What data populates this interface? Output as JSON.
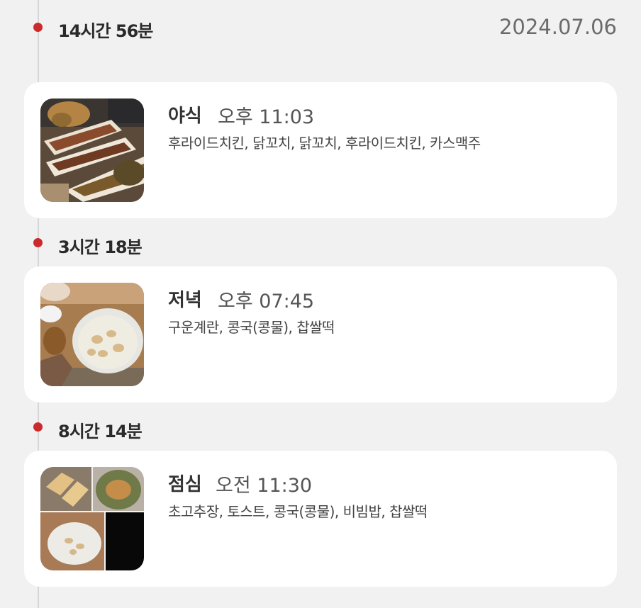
{
  "header": {
    "date": "2024.07.06"
  },
  "gaps": [
    {
      "label": "14시간 56분"
    },
    {
      "label": "3시간 18분"
    },
    {
      "label": "8시간 14분"
    }
  ],
  "meals": [
    {
      "type": "야식",
      "time": "오후 11:03",
      "foods": "후라이드치킨, 닭꼬치, 닭꼬치, 후라이드치킨, 카스맥주",
      "photo": "fried-chicken-skewers-photo"
    },
    {
      "type": "저녁",
      "time": "오후 07:45",
      "foods": "구운계란, 콩국(콩물), 찹쌀떡",
      "photo": "soy-milk-bowl-photo"
    },
    {
      "type": "점심",
      "time": "오전 11:30",
      "foods": "초고추장, 토스트, 콩국(콩물), 비빔밥, 찹쌀떡",
      "photo": "lunch-collage-photo"
    }
  ],
  "colors": {
    "timeline_dot": "#cc2a2a",
    "background": "#f1f1f1",
    "card": "#ffffff"
  }
}
